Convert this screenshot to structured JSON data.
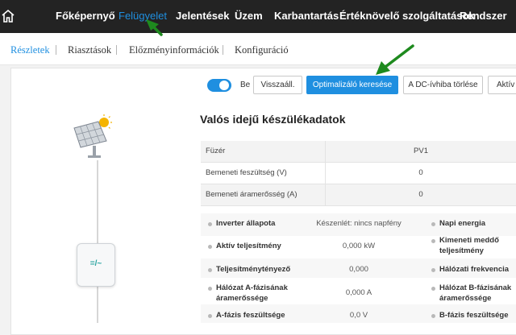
{
  "nav": {
    "items": [
      "Főképernyő",
      "Felügyelet",
      "Jelentések",
      "Üzem",
      "Karbantartás",
      "Értéknövelő szolgáltatások",
      "Rendszer"
    ],
    "active": "Felügyelet"
  },
  "subnav": {
    "tabs": [
      "Részletek",
      "Riasztások",
      "Előzményinformációk",
      "Konfiguráció"
    ],
    "active": "Részletek"
  },
  "toolbar": {
    "toggle_label": "Be",
    "buttons": [
      "Visszaáll.",
      "Optimalizáló keresése",
      "A DC-ívhiba törlése",
      "Aktív"
    ]
  },
  "section_title": "Valós idejű készülékadatok",
  "string_table": {
    "header": [
      "Füzér",
      "PV1"
    ],
    "rows": [
      [
        "Bemeneti feszültség (V)",
        "0"
      ],
      [
        "Bemeneti áramerősség (A)",
        "0"
      ]
    ]
  },
  "metrics": [
    {
      "label": "Inverter állapota",
      "value": "Készenlét: nincs napfény",
      "right_label": "Napi energia"
    },
    {
      "label": "Aktív teljesítmény",
      "value": "0,000 kW",
      "right_label": "Kimeneti meddő teljesítmény"
    },
    {
      "label": "Teljesítménytényező",
      "value": "0,000",
      "right_label": "Hálózati frekvencia"
    },
    {
      "label": "Hálózat A-fázisának áramerőssége",
      "value": "0,000 A",
      "right_label": "Hálózat B-fázisának áramerőssége"
    },
    {
      "label": "A-fázis feszültsége",
      "value": "0,0 V",
      "right_label": "B-fázis feszültsége"
    }
  ],
  "inverter_symbol": "=/~",
  "colors": {
    "accent": "#1f8fe0",
    "topbar": "#232323",
    "arrow": "#1e8a1e"
  }
}
